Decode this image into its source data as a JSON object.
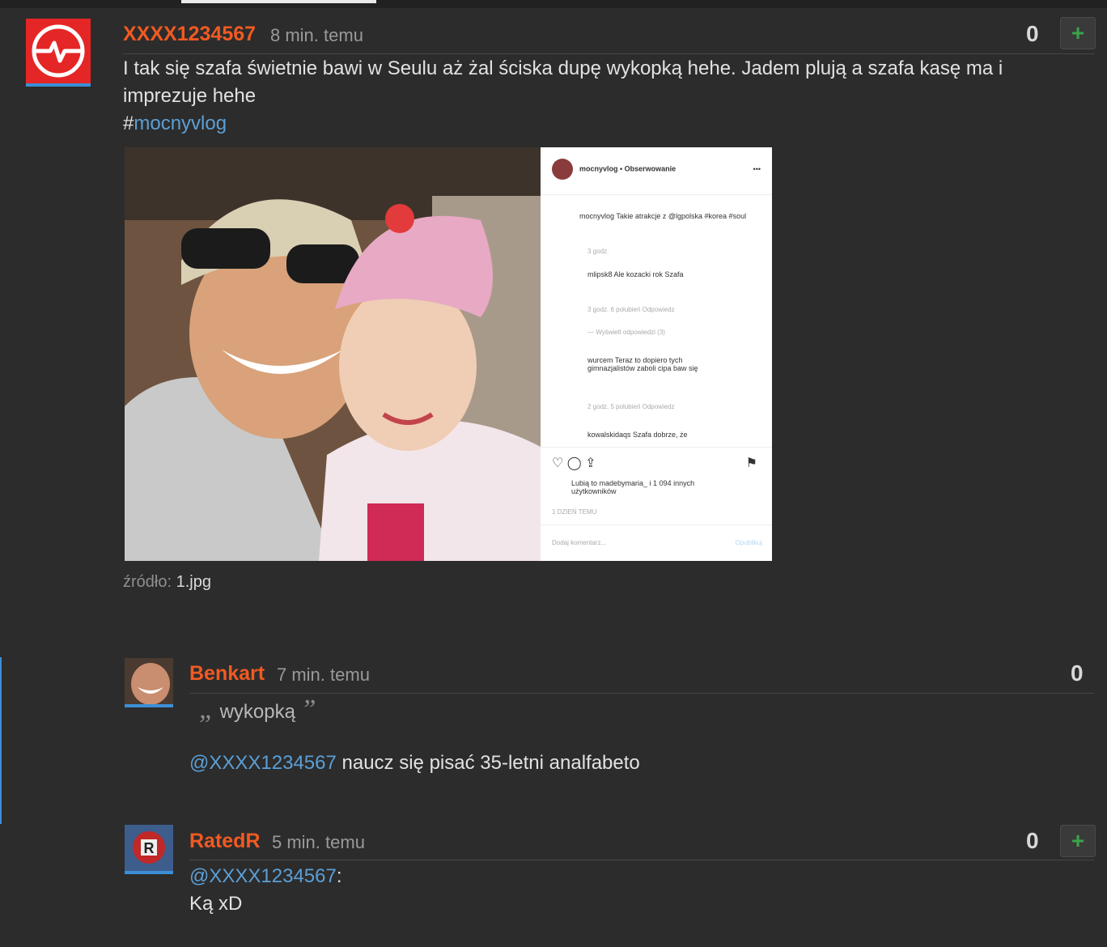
{
  "post": {
    "username": "XXXX1234567",
    "time": "8 min. temu",
    "score": "0",
    "plus": "+",
    "line1": "I tak się szafa świetnie bawi w Seulu aż żal ściska dupę wykopką hehe. Jadem plują a szafa kasę ma i",
    "line2": "imprezuje hehe",
    "tag_hash": "#",
    "tag": "mocnyvlog",
    "source_label": "źródło:",
    "source_file": "1.jpg"
  },
  "insta": {
    "header": "mocnyvlog • Obserwowanie",
    "more": "•••",
    "caption": "mocnyvlog Takie atrakcje z @lgpolska #korea #soul",
    "caption_time": "3 godz.",
    "c1": "mlipsk8 Ale kozacki rok Szafa",
    "c1_meta": "3 godz.   6 polubień   Odpowiedz",
    "view_replies": "— Wyświetl odpowiedzi (3)",
    "c2": "wurcem Teraz to dopiero tych gimnazjalistów zaboli cipa baw się",
    "c2_meta": "2 godz.   5 polubień   Odpowiedz",
    "c3": "kowalskidaqs Szafa dobrze, że",
    "likes": "Lubią to madebymaria_ i 1 094 innych użytkowników",
    "date": "1 DZIEŃ TEMU",
    "add_comment": "Dodaj komentarz...",
    "publish": "Opublikuj"
  },
  "comment1": {
    "username": "Benkart",
    "time": "7 min. temu",
    "score": "0",
    "open_quote": "„",
    "quote": "wykopką",
    "close_quote": "”",
    "mention_at": "@",
    "mention": "XXXX1234567",
    "text": " naucz się pisać 35-letni analfabeto"
  },
  "comment2": {
    "username": "RatedR",
    "time": "5 min. temu",
    "score": "0",
    "plus": "+",
    "mention_at": "@",
    "mention": "XXXX1234567",
    "colon": ":",
    "text": "Ką xD"
  }
}
